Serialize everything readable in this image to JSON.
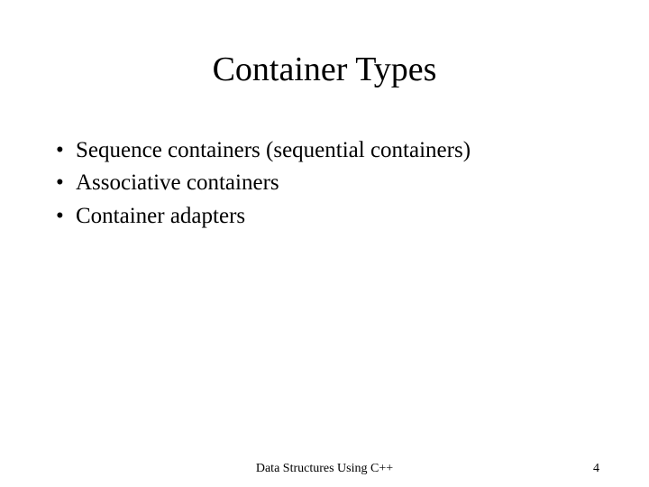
{
  "title": "Container Types",
  "bullets": [
    "Sequence containers (sequential containers)",
    "Associative containers",
    "Container adapters"
  ],
  "footer": {
    "center": "Data Structures Using C++",
    "page": "4"
  }
}
